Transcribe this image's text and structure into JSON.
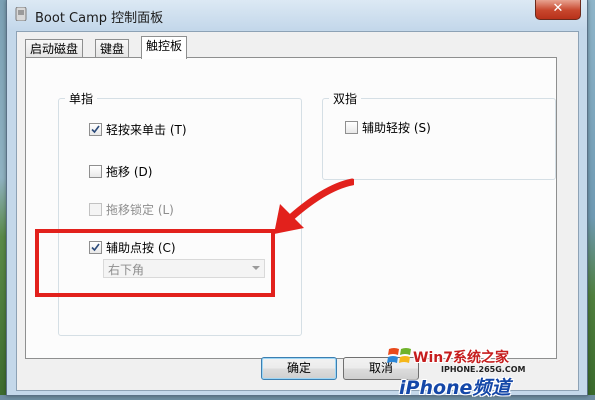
{
  "window": {
    "title": "Boot Camp 控制面板",
    "close_symbol": "✕"
  },
  "tabs": [
    {
      "label": "启动磁盘",
      "active": false
    },
    {
      "label": "键盘",
      "active": false
    },
    {
      "label": "触控板",
      "active": true
    }
  ],
  "one_finger": {
    "title": "单指",
    "tap_to_click": {
      "label": "轻按来单击 (T)",
      "checked": true,
      "enabled": true
    },
    "dragging": {
      "label": "拖移 (D)",
      "checked": false,
      "enabled": true
    },
    "drag_lock": {
      "label": "拖移锁定 (L)",
      "checked": false,
      "enabled": false
    },
    "secondary_click": {
      "label": "辅助点按 (C)",
      "checked": true,
      "enabled": true
    },
    "secondary_click_corner": {
      "value": "右下角"
    }
  },
  "two_fingers": {
    "title": "双指",
    "secondary_tap": {
      "label": "辅助轻按 (S)",
      "checked": false,
      "enabled": true
    }
  },
  "buttons": {
    "ok": "确定",
    "cancel": "取消"
  },
  "watermark": {
    "top": "Win7系统之家",
    "mid": "IPHONE.265G.COM",
    "bottom": "iPhone频道"
  },
  "colors": {
    "annotation_red": "#e2211c",
    "default_button_border": "#3c7fb1"
  }
}
